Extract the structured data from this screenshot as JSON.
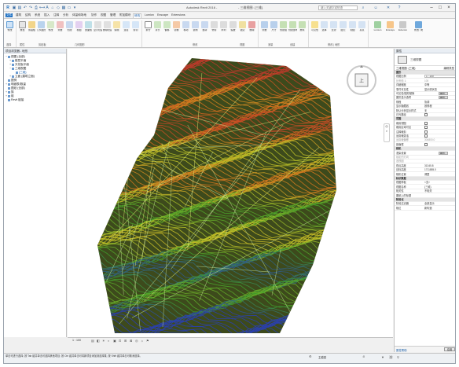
{
  "window": {
    "app_title": "Autodesk Revit 2016 -",
    "doc_title": "- 三维视图: {三维}",
    "search_placeholder": "键入关键字或短语"
  },
  "tabs": [
    "建筑",
    "结构",
    "系统",
    "插入",
    "注释",
    "分析",
    "体量和场地",
    "协作",
    "视图",
    "管理",
    "附加模块",
    "修改",
    "Lumion",
    "Enscape",
    "Extensions"
  ],
  "active_tab": "修改",
  "ribbon": {
    "buttons": [
      "修改",
      "剪贴板",
      "几何图形",
      "修改",
      "测量",
      "创建",
      "视图",
      "剖面框",
      "显示隐藏线",
      "删除隐藏线",
      "编辑",
      "连接",
      "剪切",
      "拆分",
      "对齐",
      "偏移",
      "镜像",
      "移动",
      "复制",
      "旋转",
      "修剪",
      "阵列",
      "缩放",
      "锁定",
      "删除",
      "测量",
      "尺寸",
      "创建组",
      "创建部件",
      "类似",
      "可见性",
      "选择",
      "过滤",
      "图元",
      "视图",
      "基点"
    ],
    "panels": [
      "选择",
      "属性",
      "剪贴板",
      "几何图形",
      "修改",
      "视图",
      "测量",
      "创建",
      "修改 | 地形"
    ]
  },
  "browser": {
    "title": "项目浏览器 - 地形",
    "items": [
      {
        "label": "视图 (全部)",
        "level": 0,
        "toggle": "−"
      },
      {
        "label": "楼层平面",
        "level": 1,
        "toggle": "+"
      },
      {
        "label": "天花板平面",
        "level": 1,
        "toggle": "+"
      },
      {
        "label": "三维视图",
        "level": 1,
        "toggle": "−"
      },
      {
        "label": "{三维}",
        "level": 2,
        "toggle": ""
      },
      {
        "label": "立面 (建筑立面)",
        "level": 1,
        "toggle": "+"
      },
      {
        "label": "图例",
        "level": 0,
        "toggle": ""
      },
      {
        "label": "明细表/数量",
        "level": 0,
        "toggle": "+"
      },
      {
        "label": "图纸 (全部)",
        "level": 0,
        "toggle": ""
      },
      {
        "label": "族",
        "level": 0,
        "toggle": "+"
      },
      {
        "label": "组",
        "level": 0,
        "toggle": "+"
      },
      {
        "label": "Revit 链接",
        "level": 0,
        "toggle": ""
      }
    ]
  },
  "view_cube": {
    "face_label": "上"
  },
  "properties": {
    "title": "属性",
    "type_name": "三维视图",
    "selector": "三维视图: {三维}",
    "edit_type": "编辑类型",
    "rows": [
      {
        "kind": "cat",
        "key": "图形",
        "val": ""
      },
      {
        "kind": "box",
        "key": "视图比例",
        "val": "1 : 100"
      },
      {
        "kind": "dim",
        "key": "比例值 1:",
        "val": "100"
      },
      {
        "kind": "txt",
        "key": "详细程度",
        "val": "中等"
      },
      {
        "kind": "txt",
        "key": "零件可见性",
        "val": "显示原状态"
      },
      {
        "kind": "btn",
        "key": "可见性/图形替换",
        "val": "编辑..."
      },
      {
        "kind": "btn",
        "key": "图形显示选项",
        "val": "编辑..."
      },
      {
        "kind": "txt",
        "key": "规程",
        "val": "协调"
      },
      {
        "kind": "txt",
        "key": "显示隐藏线",
        "val": "按规程"
      },
      {
        "kind": "txt",
        "key": "默认分析显示样式",
        "val": "无"
      },
      {
        "kind": "chk",
        "key": "日光路径",
        "val": ""
      },
      {
        "kind": "cat",
        "key": "范围",
        "val": ""
      },
      {
        "kind": "chk",
        "key": "裁剪视图",
        "val": ""
      },
      {
        "kind": "chk",
        "key": "裁剪区域可见",
        "val": ""
      },
      {
        "kind": "chk",
        "key": "注释裁剪",
        "val": ""
      },
      {
        "kind": "chk",
        "key": "远剪裁激活",
        "val": ""
      },
      {
        "kind": "dim",
        "key": "远剪裁偏移",
        "val": "304800.0"
      },
      {
        "kind": "chk",
        "key": "剖面框",
        "val": ""
      },
      {
        "kind": "cat",
        "key": "相机",
        "val": ""
      },
      {
        "kind": "btn",
        "key": "渲染设置",
        "val": "编辑..."
      },
      {
        "kind": "dim",
        "key": "锁定的方向",
        "val": ""
      },
      {
        "kind": "dim",
        "key": "透视图",
        "val": ""
      },
      {
        "kind": "txt",
        "key": "视点高度",
        "val": "31345.8"
      },
      {
        "kind": "txt",
        "key": "目标高度",
        "val": "1711855.0"
      },
      {
        "kind": "txt",
        "key": "相机位置",
        "val": "调整"
      },
      {
        "kind": "cat",
        "key": "标识数据",
        "val": ""
      },
      {
        "kind": "txt",
        "key": "视图样板",
        "val": "<无>"
      },
      {
        "kind": "txt",
        "key": "视图名称",
        "val": "{三维}"
      },
      {
        "kind": "txt",
        "key": "相关性",
        "val": "不相关"
      },
      {
        "kind": "txt",
        "key": "图纸上的标题",
        "val": ""
      },
      {
        "kind": "cat",
        "key": "阶段化",
        "val": ""
      },
      {
        "kind": "txt",
        "key": "阶段过滤器",
        "val": "全部显示"
      },
      {
        "kind": "txt",
        "key": "相位",
        "val": "新构造"
      }
    ],
    "help_link": "属性帮助",
    "apply": "应用"
  },
  "viewbar": {
    "scale": "1 : 100"
  },
  "status": {
    "text": "单击可进行选择; 按 Tab 键并单击可选择其他项目; 按 Ctrl 键并单击可将新项目添加到选择集; 按 Shift 键并单击可取消选择。",
    "model": "主模型",
    "zero": ":0"
  },
  "colors": {
    "accent": "#1b6ec2",
    "terrain_low": "#2a3fb0",
    "terrain_mid": "#3fa12a",
    "terrain_high": "#c0392b"
  }
}
